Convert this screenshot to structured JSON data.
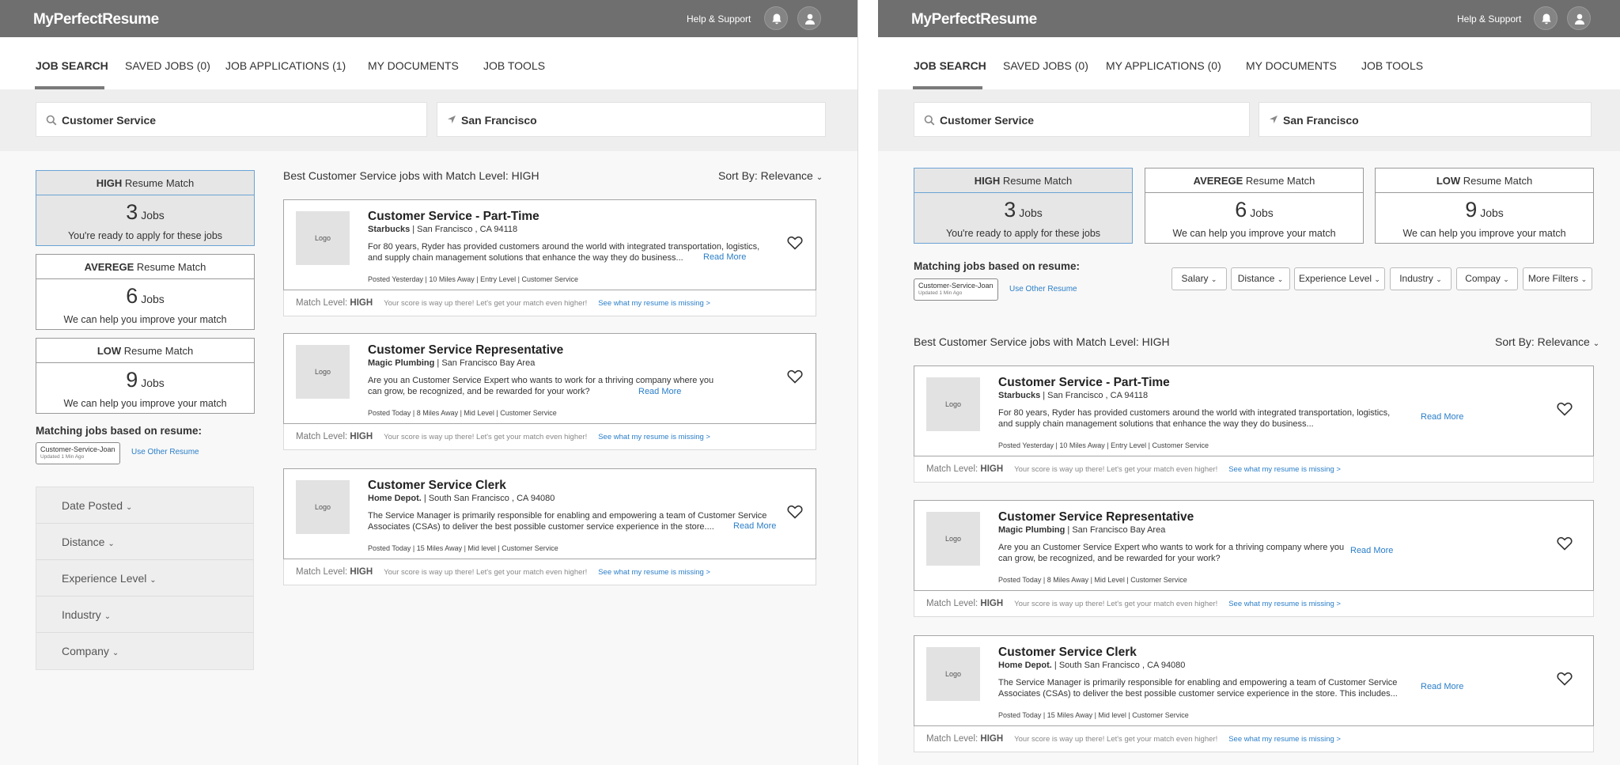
{
  "brand": "MyPerfectResume",
  "help": "Help & Support",
  "left": {
    "tabs": [
      "JOB SEARCH",
      "SAVED JOBS (0)",
      "JOB APPLICATIONS (1)",
      "MY DOCUMENTS",
      "JOB TOOLS"
    ],
    "search": "Customer Service",
    "location": "San Francisco",
    "match_boxes": [
      {
        "level": "HIGH",
        "suffix": " Resume Match",
        "count": "3",
        "unit": "Jobs",
        "sub": "You're ready to apply for these jobs"
      },
      {
        "level": "AVEREGE",
        "suffix": " Resume Match",
        "count": "6",
        "unit": "Jobs",
        "sub": "We can help you improve your match"
      },
      {
        "level": "LOW",
        "suffix": " Resume Match",
        "count": "9",
        "unit": "Jobs",
        "sub": "We can help you improve your match"
      }
    ],
    "matching_title": "Matching jobs based on resume:",
    "resume_tag": "Customer-Service-Joan",
    "resume_updated": "Updated 1 Min Ago",
    "use_other": "Use Other Resume",
    "filters": [
      "Date Posted",
      "Distance",
      "Experience Level",
      "Industry",
      "Company"
    ]
  },
  "right": {
    "tabs": [
      "JOB SEARCH",
      "SAVED JOBS (0)",
      "MY APPLICATIONS (0)",
      "MY DOCUMENTS",
      "JOB TOOLS"
    ],
    "search": "Customer Service",
    "location": "San Francisco",
    "match_boxes": [
      {
        "level": "HIGH",
        "suffix": " Resume Match",
        "count": "3",
        "unit": "Jobs",
        "sub": "You're ready to apply for these jobs"
      },
      {
        "level": "AVEREGE",
        "suffix": " Resume Match",
        "count": "6",
        "unit": "Jobs",
        "sub": "We can help you improve your match"
      },
      {
        "level": "LOW",
        "suffix": " Resume Match",
        "count": "9",
        "unit": "Jobs",
        "sub": "We can help you improve your match"
      }
    ],
    "matching_title": "Matching jobs based on resume:",
    "resume_tag": "Customer-Service-Joan",
    "resume_updated": "Updated 1 Min Ago",
    "use_other": "Use Other Resume",
    "filter_pills": [
      "Salary",
      "Distance",
      "Experience Level",
      "Industry",
      "Compay",
      "More Filters"
    ]
  },
  "results_heading": "Best Customer Service jobs with Match Level: HIGH",
  "sort_label": "Sort By: Relevance",
  "logo_placeholder": "Logo",
  "read_more": "Read More",
  "match_level_label": "Match Level:",
  "match_level_value": "HIGH",
  "match_message": "Your score is way up there! Let's get your match even higher!",
  "missing_link": "See what my resume is missing >",
  "jobs_left": [
    {
      "title": "Customer Service - Part-Time",
      "company": "Starbucks",
      "location": " | San Francisco , CA 94118",
      "desc": "For 80 years, Ryder has provided customers around the world with integrated transportation, logistics, and supply chain management solutions that enhance the way they do business...",
      "meta": "Posted Yesterday  |  10 Miles Away  |  Entry Level  |  Customer Service"
    },
    {
      "title": "Customer Service Representative",
      "company": "Magic Plumbing",
      "location": " | San Francisco Bay Area",
      "desc": "Are you an Customer Service Expert who wants to work for a thriving company where you can grow, be recognized, and be rewarded for your work?",
      "meta": "Posted Today  |  8 Miles Away  |  Mid Level  |  Customer Service"
    },
    {
      "title": "Customer Service Clerk",
      "company": "Home Depot.",
      "location": " | South San Francisco , CA 94080",
      "desc": "The Service Manager is primarily responsible for enabling and empowering a team of Customer Service Associates (CSAs) to deliver the best possible customer service experience in the store....",
      "meta": "Posted Today  |  15 Miles Away  |  Mid level  |  Customer Service"
    }
  ],
  "jobs_right": [
    {
      "title": "Customer Service - Part-Time",
      "company": "Starbucks",
      "location": " | San Francisco , CA 94118",
      "desc": "For 80 years, Ryder has provided customers around the world with integrated transportation, logistics, and supply chain management solutions that enhance the way they do business...",
      "meta": "Posted Yesterday  |  10 Miles Away  |  Entry Level  |  Customer Service"
    },
    {
      "title": "Customer Service Representative",
      "company": "Magic Plumbing",
      "location": " | San Francisco Bay Area",
      "desc": "Are you an Customer Service Expert who wants to work for a thriving company where you can grow, be recognized, and be rewarded for your work?",
      "meta": "Posted Today  |  8 Miles Away  |  Mid Level  |  Customer Service"
    },
    {
      "title": "Customer Service Clerk",
      "company": "Home Depot.",
      "location": " | South San Francisco , CA 94080",
      "desc": "The Service Manager is primarily responsible for enabling and empowering a team of Customer Service Associates (CSAs) to deliver the best possible customer service experience in the store. This includes...",
      "meta": "Posted Today  |  15 Miles Away  |  Mid level  |  Customer Service"
    }
  ]
}
